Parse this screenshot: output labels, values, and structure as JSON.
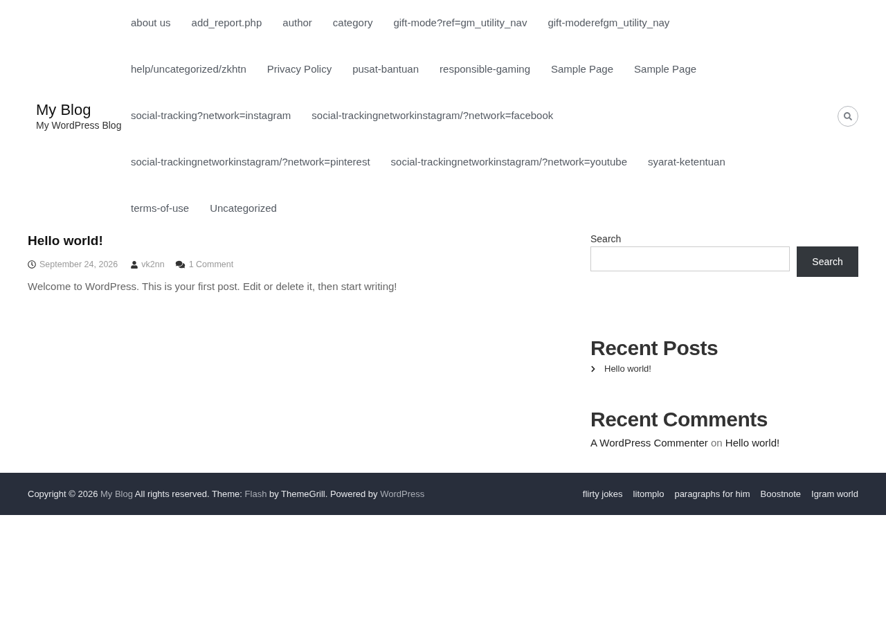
{
  "site": {
    "title": "My Blog",
    "tagline": "My WordPress Blog"
  },
  "primary_menu": {
    "rows": [
      {
        "items": [
          "about us",
          "add_report.php",
          "author",
          "category",
          "gift-mode?ref=gm_utility_nav",
          "gift-moderefgm_utility_nay"
        ]
      },
      {
        "items": [
          "help/uncategorized/zkhtn",
          "Privacy Policy",
          "pusat-bantuan",
          "responsible-gaming",
          "Sample Page",
          "Sample Page"
        ]
      },
      {
        "items": [
          "social-tracking?network=instagram",
          "social-trackingnetworkinstagram/?network=facebook"
        ]
      },
      {
        "items": [
          "social-trackingnetworkinstagram/?network=pinterest",
          "social-trackingnetworkinstagram/?network=youtube",
          "syarat-ketentuan"
        ]
      },
      {
        "items": [
          "terms-of-use",
          "Uncategorized"
        ]
      }
    ]
  },
  "post": {
    "title": "Hello world!",
    "date": "September 24, 2026",
    "author": "vk2nn",
    "comments": "1 Comment",
    "excerpt": "Welcome to WordPress. This is your first post. Edit or delete it, then start writing!"
  },
  "sidebar": {
    "search": {
      "label": "Search",
      "button": "Search"
    },
    "recent_posts": {
      "title": "Recent Posts",
      "items": [
        "Hello world!"
      ]
    },
    "recent_comments": {
      "title": "Recent Comments",
      "items": [
        {
          "author": "A WordPress Commenter",
          "joiner": "on",
          "post": "Hello world!"
        }
      ]
    }
  },
  "footer": {
    "copyright": [
      {
        "kind": "text",
        "text": "Copyright © 2026"
      },
      {
        "kind": "link",
        "text": "My Blog"
      },
      {
        "kind": "text",
        "text": "All rights reserved. Theme:"
      },
      {
        "kind": "link",
        "text": "Flash"
      },
      {
        "kind": "text",
        "text": "by ThemeGrill. Powered by"
      },
      {
        "kind": "link",
        "text": "WordPress"
      }
    ],
    "menu": [
      "flirty jokes",
      "litomplo",
      "paragraphs for him",
      "Boostnote",
      "Igram world"
    ]
  }
}
